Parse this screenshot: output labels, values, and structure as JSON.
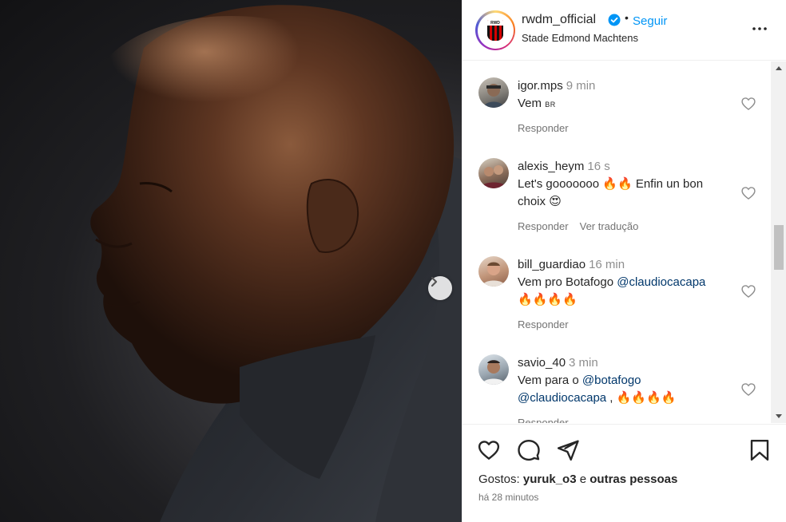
{
  "post": {
    "image_alt": "Close-up profile of a man in a dark hooded jacket",
    "next_label": "Next"
  },
  "header": {
    "username": "rwdm_official",
    "separator": "•",
    "follow": "Seguir",
    "location": "Stade Edmond Machtens",
    "logo_text": "RWD"
  },
  "comments": [
    {
      "user": "igor.mps",
      "time": "9 min",
      "text_parts": [
        "Vem ",
        "BR"
      ],
      "actions": [
        "Responder"
      ]
    },
    {
      "user": "alexis_heym",
      "time": "16 s",
      "text_parts": [
        "Let's gooooooo ",
        "🔥🔥",
        " Enfin un bon choix ",
        "😍"
      ],
      "actions": [
        "Responder",
        "Ver tradução"
      ]
    },
    {
      "user": "bill_guardiao",
      "time": "16 min",
      "text_parts": [
        "Vem pro Botafogo ",
        "@claudiocacapa",
        "🔥🔥🔥🔥"
      ],
      "actions": [
        "Responder"
      ]
    },
    {
      "user": "savio_40",
      "time": "3 min",
      "text_parts": [
        "Vem para o ",
        "@botafogo",
        "@claudiocacapa",
        " , ",
        "🔥🔥🔥🔥"
      ],
      "actions": [
        "Responder"
      ]
    }
  ],
  "footer": {
    "likes_prefix": "Gostos: ",
    "likes_user": "yuruk_o3",
    "likes_suffix": " e ",
    "likes_others": "outras pessoas",
    "time_ago": "há 28 minutos"
  },
  "colors": {
    "accent": "#0095f6",
    "mention": "#00376b",
    "muted": "#737373"
  }
}
